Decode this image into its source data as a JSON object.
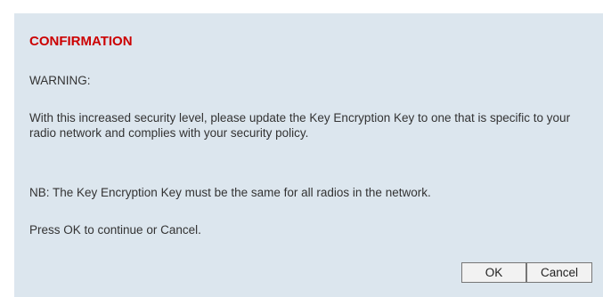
{
  "dialog": {
    "title": "CONFIRMATION",
    "warning": "WARNING:",
    "body": "With this increased security level, please update the Key Encryption Key to one that is specific to your radio network and complies with your security policy.",
    "note": "NB: The Key Encryption Key must be the same for all radios in the network.",
    "instruction": "Press OK to continue or Cancel.",
    "ok_label": "OK",
    "cancel_label": "Cancel"
  },
  "colors": {
    "title": "#cc0000",
    "dialog_background": "#dce6ee",
    "text": "#333333"
  }
}
